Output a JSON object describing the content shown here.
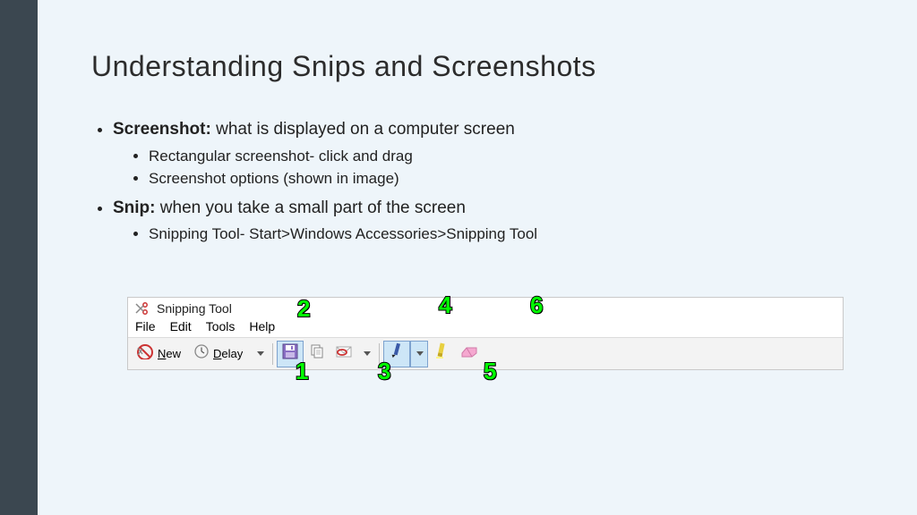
{
  "title": "Understanding Snips and Screenshots",
  "bullet1": {
    "term": "Screenshot:",
    "rest": " what is displayed on a computer screen",
    "subs": [
      "Rectangular screenshot- click and drag",
      "Screenshot options (shown in image)"
    ]
  },
  "bullet2": {
    "term": "Snip:",
    "rest": " when you take a small part of the screen",
    "subs": [
      "Snipping Tool- Start>Windows Accessories>Snipping Tool"
    ]
  },
  "snip": {
    "title": "Snipping Tool",
    "menu": {
      "file": "File",
      "edit": "Edit",
      "tools": "Tools",
      "help": "Help"
    },
    "toolbar": {
      "new": "New",
      "new_u": "N",
      "delay": "Delay",
      "delay_u": "D"
    }
  },
  "callouts": {
    "c1": "1",
    "c2": "2",
    "c3": "3",
    "c4": "4",
    "c5": "5",
    "c6": "6"
  }
}
